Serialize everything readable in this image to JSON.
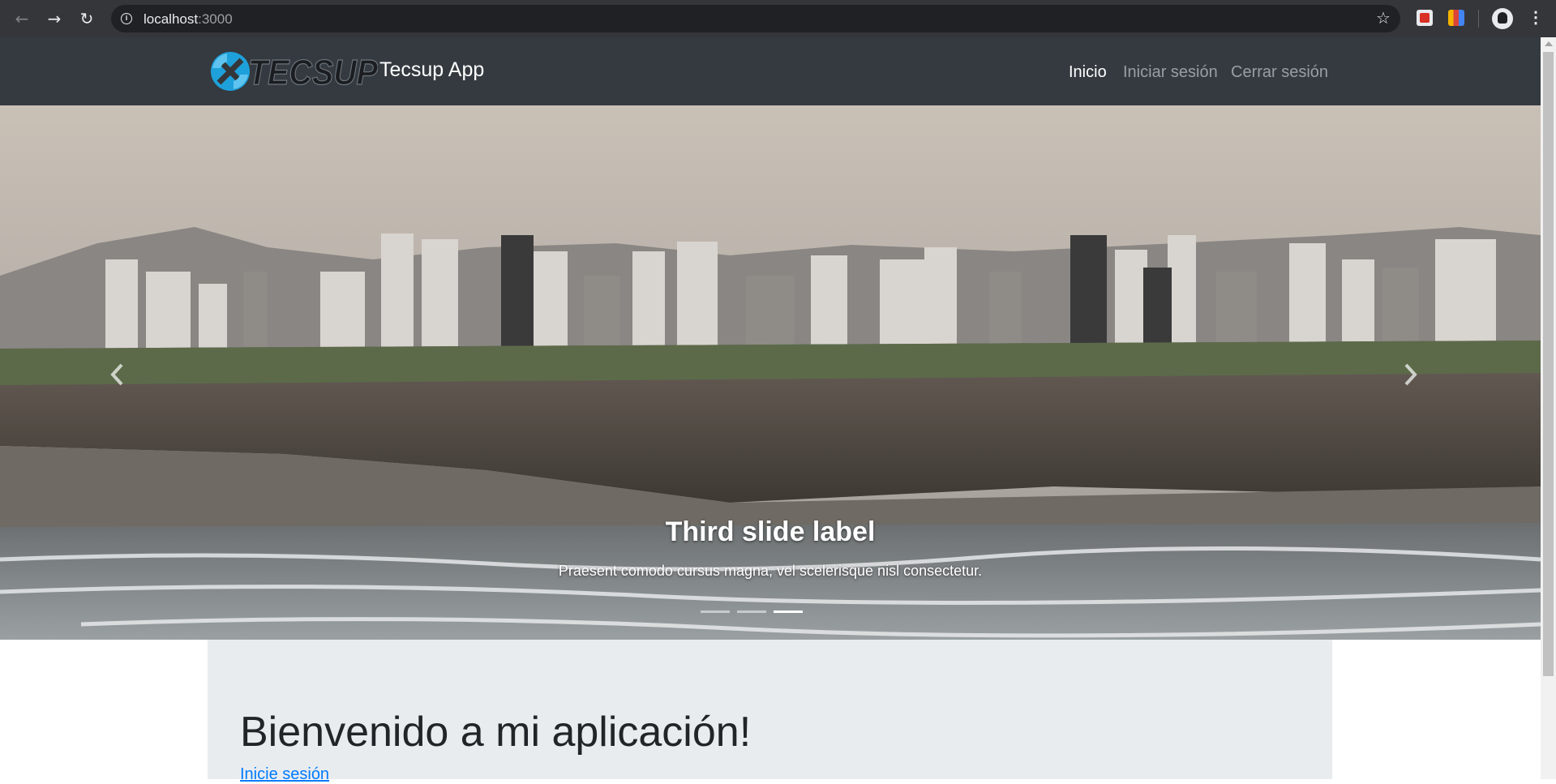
{
  "browser": {
    "url_host": "localhost",
    "url_port": ":3000",
    "icons": [
      "back-arrow-icon",
      "forward-arrow-icon",
      "reload-icon",
      "site-info-icon",
      "bookmark-star-icon",
      "extension-icon",
      "extension-color-icon",
      "profile-avatar-icon",
      "browser-menu-icon"
    ]
  },
  "navbar": {
    "brand_logo_text": "TECSUP",
    "brand": "Tecsup App",
    "links": [
      {
        "label": "Inicio",
        "active": true
      },
      {
        "label": "Iniciar sesión",
        "active": false
      },
      {
        "label": "Cerrar sesión",
        "active": false
      }
    ]
  },
  "carousel": {
    "caption_title": "Third slide label",
    "caption_text": "Praesent comodo cursus magna, vel scelerisque nisl consectetur.",
    "slide_count": 3,
    "active_slide": 3,
    "icons": [
      "carousel-prev-icon",
      "carousel-next-icon"
    ]
  },
  "jumbotron": {
    "title": "Bienvenido a mi aplicación!",
    "link": "Inicie sesión"
  },
  "colors": {
    "navbar_bg": "#343a40",
    "jumbotron_bg": "#e9ecef",
    "link": "#007bff",
    "chrome_bg": "#35363a"
  }
}
